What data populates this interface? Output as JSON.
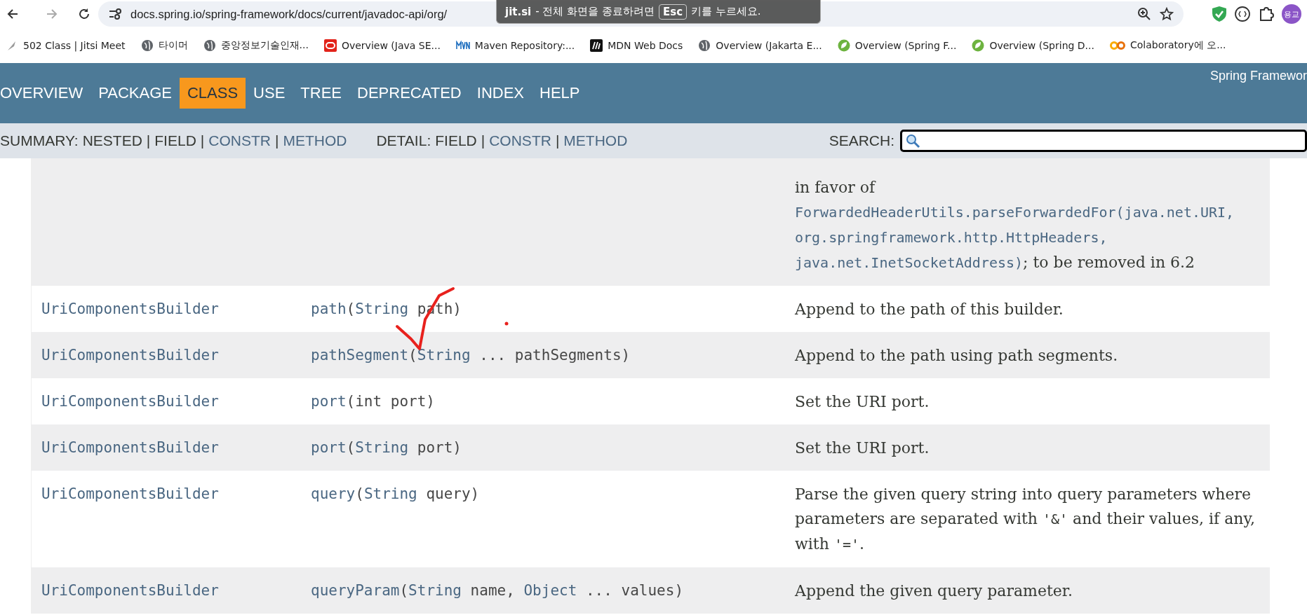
{
  "browser": {
    "url": "docs.spring.io/spring-framework/docs/current/javadoc-api/org/",
    "profile": "용교"
  },
  "fullscreen_notice": {
    "brand": "jit.si",
    "before_key": "- 전체 화면을 종료하려면",
    "key": "Esc",
    "after_key": "키를 누르세요."
  },
  "bookmarks": [
    {
      "label": "502 Class | Jitsi Meet",
      "kind": "feather"
    },
    {
      "label": "타이머",
      "kind": "globe"
    },
    {
      "label": "중앙정보기술인재...",
      "kind": "globe"
    },
    {
      "label": "Overview (Java SE...",
      "kind": "oracle"
    },
    {
      "label": "Maven Repository:...",
      "kind": "maven"
    },
    {
      "label": "MDN Web Docs",
      "kind": "mdn"
    },
    {
      "label": "Overview (Jakarta E...",
      "kind": "globe"
    },
    {
      "label": "Overview (Spring F...",
      "kind": "leaf"
    },
    {
      "label": "Overview (Spring D...",
      "kind": "leaf"
    },
    {
      "label": "Colaboratory에 오...",
      "kind": "colab"
    }
  ],
  "nav": {
    "items": [
      {
        "label": "OVERVIEW",
        "selected": false
      },
      {
        "label": "PACKAGE",
        "selected": false
      },
      {
        "label": "CLASS",
        "selected": true
      },
      {
        "label": "USE",
        "selected": false
      },
      {
        "label": "TREE",
        "selected": false
      },
      {
        "label": "DEPRECATED",
        "selected": false
      },
      {
        "label": "INDEX",
        "selected": false
      },
      {
        "label": "HELP",
        "selected": false
      }
    ],
    "title": "Spring Framewor"
  },
  "subnav": {
    "groups": [
      {
        "label": "SUMMARY:",
        "items": [
          {
            "text": "NESTED",
            "kind": "plain"
          },
          {
            "text": "|",
            "kind": "separator"
          },
          {
            "text": "FIELD",
            "kind": "plain"
          },
          {
            "text": "|",
            "kind": "separator"
          },
          {
            "text": "CONSTR",
            "kind": "link"
          },
          {
            "text": "|",
            "kind": "separator"
          },
          {
            "text": "METHOD",
            "kind": "link"
          }
        ]
      },
      {
        "label": "DETAIL:",
        "items": [
          {
            "text": "FIELD",
            "kind": "plain"
          },
          {
            "text": "|",
            "kind": "separator"
          },
          {
            "text": "CONSTR",
            "kind": "link"
          },
          {
            "text": "|",
            "kind": "separator"
          },
          {
            "text": "METHOD",
            "kind": "link"
          }
        ]
      }
    ],
    "search_label": "SEARCH:"
  },
  "rows": [
    {
      "method": [],
      "description": [
        {
          "text": "in favor of ",
          "kind": "text"
        },
        {
          "text": "ForwardedHeaderUtils.parseForwardedFor(java.net.URI,",
          "kind": "link"
        },
        {
          "text": "org.springframework.http.HttpHeaders,",
          "kind": "link"
        },
        {
          "text": "java.net.InetSocketAddress)",
          "kind": "link"
        },
        {
          "text": "; to be removed in 6.2",
          "kind": "text"
        }
      ]
    },
    {
      "type": "UriComponentsBuilder",
      "method": [
        {
          "text": "path",
          "kind": "link"
        },
        {
          "text": "(",
          "kind": "plain"
        },
        {
          "text": "String",
          "kind": "link"
        },
        {
          "text": " path)",
          "kind": "plain"
        }
      ],
      "description": [
        {
          "text": "Append to the path of this builder.",
          "kind": "text"
        }
      ]
    },
    {
      "type": "UriComponentsBuilder",
      "method": [
        {
          "text": "pathSegment",
          "kind": "link"
        },
        {
          "text": "(",
          "kind": "plain"
        },
        {
          "text": "String",
          "kind": "link"
        },
        {
          "text": " ... pathSegments)",
          "kind": "plain"
        }
      ],
      "description": [
        {
          "text": "Append to the path using path segments.",
          "kind": "text"
        }
      ]
    },
    {
      "type": "UriComponentsBuilder",
      "method": [
        {
          "text": "port",
          "kind": "link"
        },
        {
          "text": "(int port)",
          "kind": "plain"
        }
      ],
      "description": [
        {
          "text": "Set the URI port.",
          "kind": "text"
        }
      ]
    },
    {
      "type": "UriComponentsBuilder",
      "method": [
        {
          "text": "port",
          "kind": "link"
        },
        {
          "text": "(",
          "kind": "plain"
        },
        {
          "text": "String",
          "kind": "link"
        },
        {
          "text": " port)",
          "kind": "plain"
        }
      ],
      "description": [
        {
          "text": "Set the URI port.",
          "kind": "text"
        }
      ]
    },
    {
      "type": "UriComponentsBuilder",
      "method": [
        {
          "text": "query",
          "kind": "link"
        },
        {
          "text": "(",
          "kind": "plain"
        },
        {
          "text": "String",
          "kind": "link"
        },
        {
          "text": " query)",
          "kind": "plain"
        }
      ],
      "description": [
        {
          "text": "Parse the given query string into query parameters where parameters are separated with ",
          "kind": "text"
        },
        {
          "text": "'&'",
          "kind": "code"
        },
        {
          "text": " and their values, if any, with ",
          "kind": "text"
        },
        {
          "text": "'='",
          "kind": "code"
        },
        {
          "text": ".",
          "kind": "text"
        }
      ]
    },
    {
      "type": "UriComponentsBuilder",
      "method": [
        {
          "text": "queryParam",
          "kind": "link"
        },
        {
          "text": "(",
          "kind": "plain"
        },
        {
          "text": "String",
          "kind": "link"
        },
        {
          "text": " name, ",
          "kind": "plain"
        },
        {
          "text": "Object",
          "kind": "link"
        },
        {
          "text": " ... values)",
          "kind": "plain"
        }
      ],
      "description": [
        {
          "text": "Append the given query parameter.",
          "kind": "text"
        }
      ]
    }
  ],
  "annotations": {
    "checkmark": {
      "color": "#e8211d"
    },
    "dot": {
      "color": "#e8211d"
    }
  }
}
